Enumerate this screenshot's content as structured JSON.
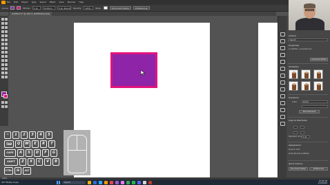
{
  "menubar": {
    "items": [
      "File",
      "Edit",
      "Object",
      "Type",
      "Select",
      "Effect",
      "View",
      "Window",
      "Help"
    ]
  },
  "controlbar": {
    "mode_label": "Group",
    "stroke_label": "Stroke:",
    "stroke_value": "1 pt",
    "profile_value": "Uniform",
    "brush_value": "5 pt. Round",
    "opacity_label": "Opacity:",
    "opacity_value": "100%",
    "style_label": "Style:",
    "doc_setup_label": "Document Setup",
    "preferences_label": "Preferences"
  },
  "document": {
    "tab_title": "Untitled-1* @ 100 % (CMYK/Preview)"
  },
  "colors": {
    "fill": "#8e24a8",
    "stroke": "#e2137c",
    "accent": "#ff9a00"
  },
  "panel": {
    "tab_label": "Actions",
    "search_text": "Search",
    "heading_properties": "Properties",
    "ai_text": "In addition...AI-enhanced...",
    "generate_label": "Generate (Beta)",
    "section_variations": "Variations",
    "section_transform": "Transform",
    "section_align": "Align & Distribute",
    "section_appearance": "Appearance",
    "section_quick_actions": "Quick Actions",
    "document_setup_label": "Document Setup",
    "preferences_label": "Preferences",
    "edit_artboards_label": "Edit Artboards",
    "units_label": "Units:",
    "units_value": "Points",
    "scale_strokes_label": "Scale Strokes & Effects",
    "keyboard_increment_label": "Keyboard Increment:",
    "keyboard_increment_value": "1 pt",
    "snap_to_grid_label": "Snap to Grid"
  },
  "keyboard_overlay": {
    "row1": [
      "~",
      "1",
      "2",
      "3",
      "4",
      "5"
    ],
    "row2": [
      "TAB",
      "Q",
      "W",
      "E",
      "R",
      "T"
    ],
    "row3": [
      "CAPS",
      "A",
      "S",
      "D",
      "F",
      "G"
    ],
    "row4": [
      "SHIFT",
      "Z",
      "X",
      "C",
      "V",
      "B"
    ],
    "row5": [
      "CTRL",
      "⊞",
      "ALT"
    ]
  },
  "statusbar": {
    "zoom": "100%"
  },
  "taskbar": {
    "weather_temp": "44°F",
    "weather_desc": "Mostly cloudy",
    "search_placeholder": "Search",
    "time": "10:38 AM",
    "date": "2/15/2024"
  }
}
